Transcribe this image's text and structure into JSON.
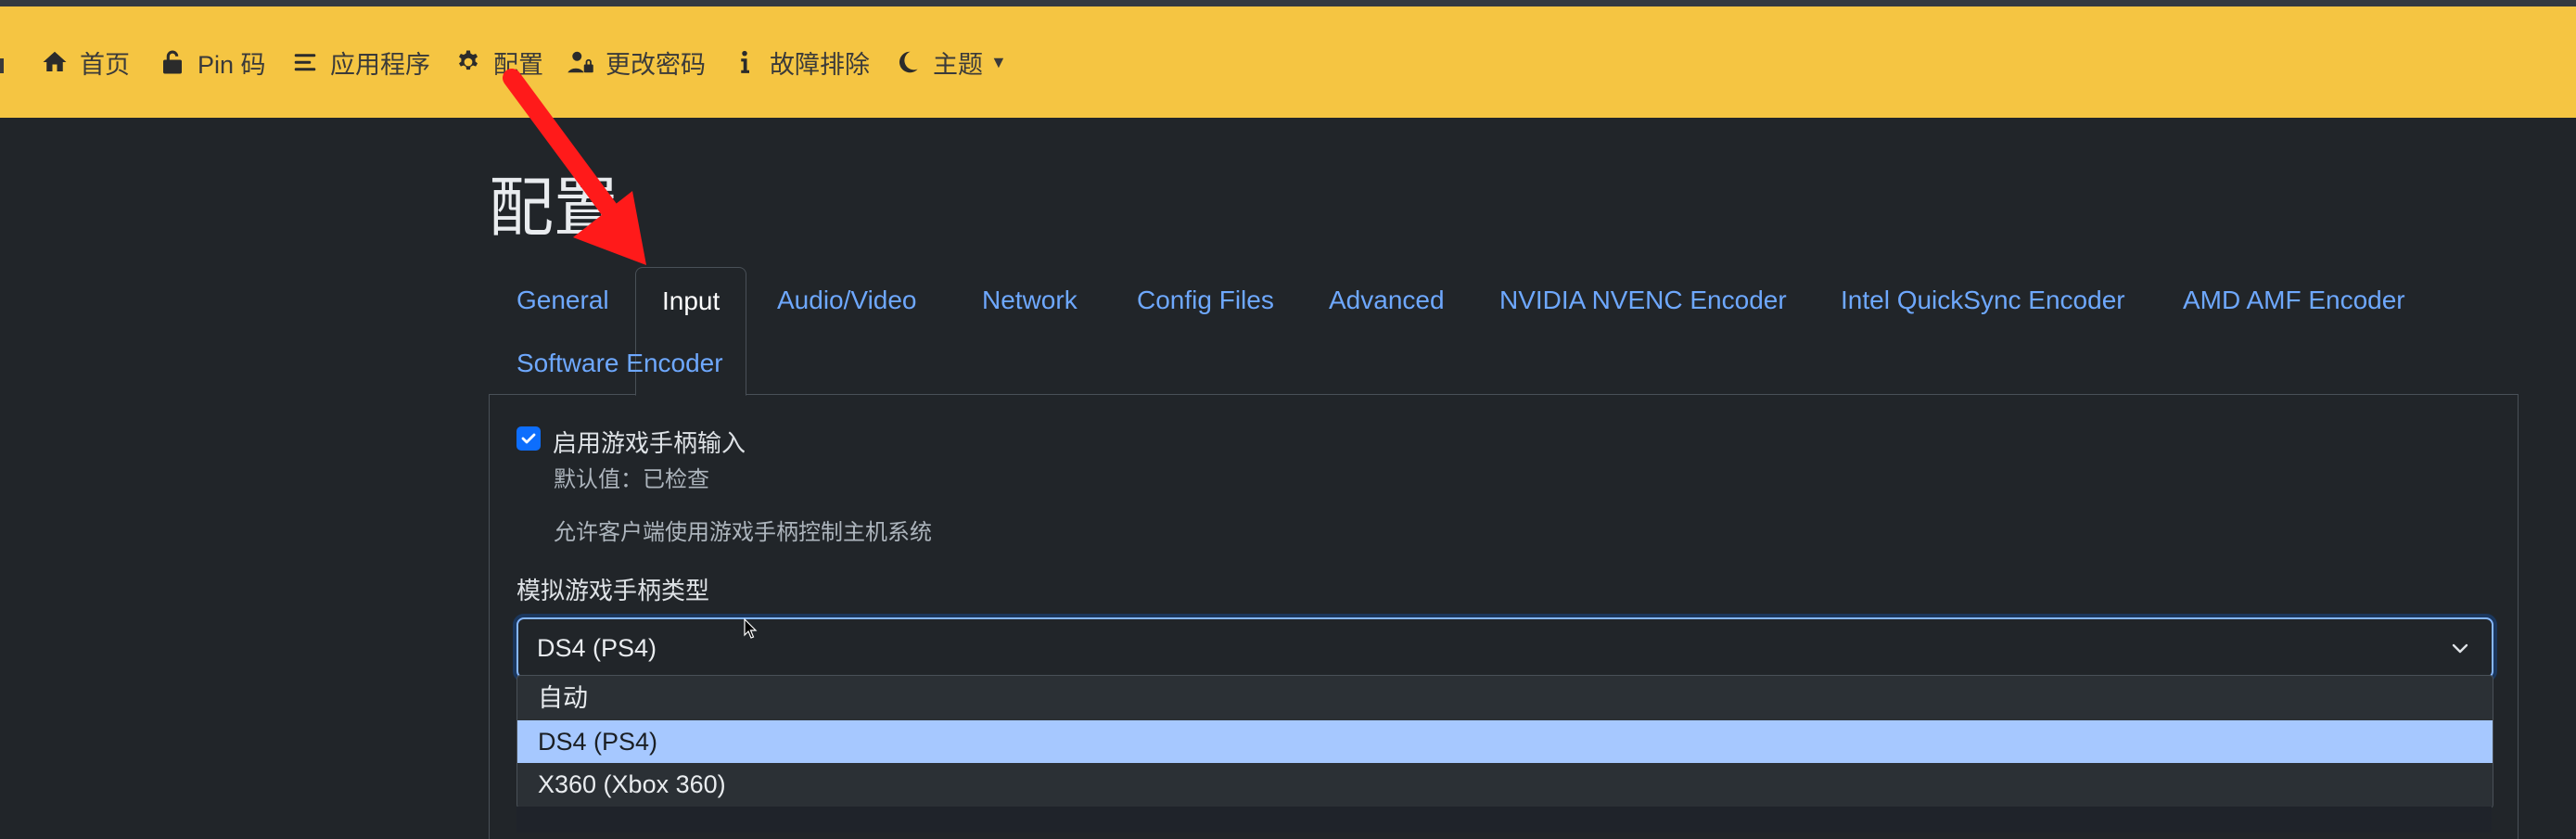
{
  "nav": {
    "items": [
      {
        "label": "首页",
        "icon": "home-icon"
      },
      {
        "label": "Pin 码",
        "icon": "unlock-icon"
      },
      {
        "label": "应用程序",
        "icon": "list-icon"
      },
      {
        "label": "配置",
        "icon": "gear-icon"
      },
      {
        "label": "更改密码",
        "icon": "user-lock-icon"
      },
      {
        "label": "故障排除",
        "icon": "info-icon"
      },
      {
        "label": "主题",
        "icon": "moon-icon"
      }
    ]
  },
  "page": {
    "title": "配置"
  },
  "tabs": [
    {
      "label": "General",
      "active": false
    },
    {
      "label": "Input",
      "active": true
    },
    {
      "label": "Audio/Video",
      "active": false
    },
    {
      "label": "Network",
      "active": false
    },
    {
      "label": "Config Files",
      "active": false
    },
    {
      "label": "Advanced",
      "active": false
    },
    {
      "label": "NVIDIA NVENC Encoder",
      "active": false
    },
    {
      "label": "Intel QuickSync Encoder",
      "active": false
    },
    {
      "label": "AMD AMF Encoder",
      "active": false
    },
    {
      "label": "Software Encoder",
      "active": false
    }
  ],
  "gamepad": {
    "checkbox_label": "启用游戏手柄输入",
    "checked": true,
    "default_text": "默认值：已检查",
    "description": "允许客户端使用游戏手柄控制主机系统"
  },
  "emulation": {
    "label": "模拟游戏手柄类型",
    "selected": "DS4 (PS4)",
    "options": [
      "自动",
      "DS4 (PS4)",
      "X360 (Xbox 360)"
    ]
  },
  "colors": {
    "navbar": "#f5c542",
    "background": "#212529",
    "link": "#6ea8fe",
    "highlight": "#a6c8ff",
    "annotation_arrow": "#ff1a1a"
  }
}
